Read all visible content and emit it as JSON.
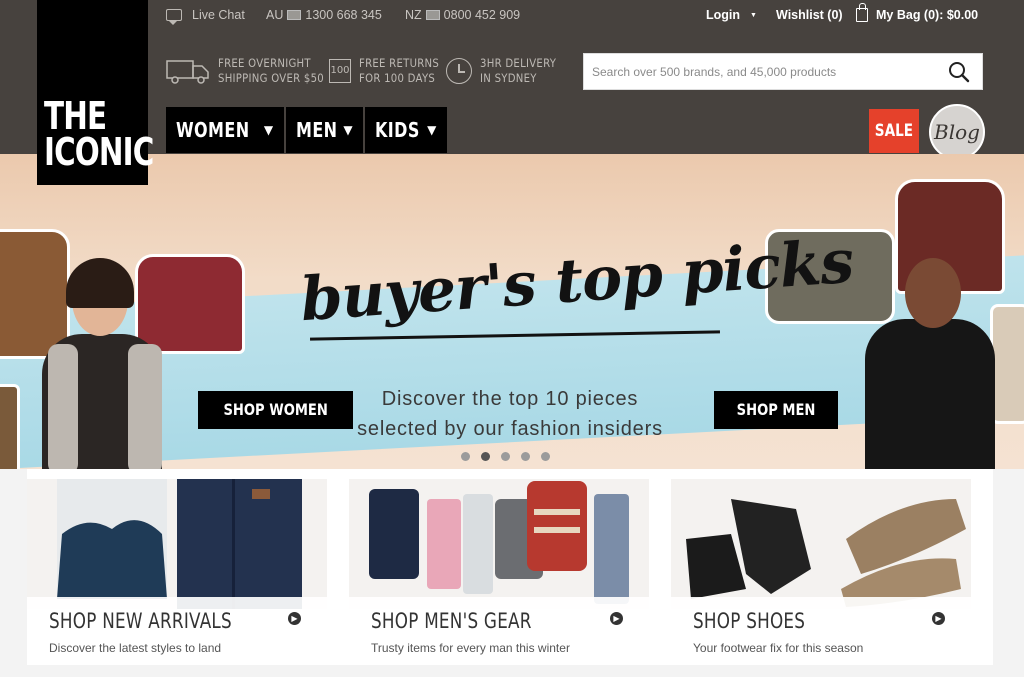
{
  "brand": {
    "line1": "THE",
    "line2": "ICONIC"
  },
  "topbar": {
    "live_chat": "Live Chat",
    "au_label": "AU",
    "au_phone": "1300 668 345",
    "nz_label": "NZ",
    "nz_phone": "0800 452 909",
    "login": "Login",
    "login_caret": "▼",
    "wishlist": "Wishlist (0)",
    "bag": "My Bag (0): $0.00"
  },
  "benefits": [
    {
      "line1": "FREE OVERNIGHT",
      "line2": "SHIPPING OVER $50",
      "icon": "truck-icon"
    },
    {
      "line1": "FREE RETURNS",
      "line2": "FOR 100 DAYS",
      "icon": "returns-box-icon",
      "icon_text": "100"
    },
    {
      "line1": "3HR DELIVERY",
      "line2": "IN SYDNEY",
      "icon": "clock-icon"
    }
  ],
  "search": {
    "placeholder": "Search over 500 brands, and 45,000 products",
    "value": ""
  },
  "nav": [
    {
      "label": "WOMEN",
      "caret": "▼"
    },
    {
      "label": "MEN",
      "caret": "▼"
    },
    {
      "label": "KIDS",
      "caret": "▼"
    }
  ],
  "sale_label": "SALE",
  "blog_label": "Blog",
  "hero": {
    "tagline": "buyer's top picks",
    "copy_line1": "Discover the top 10 pieces",
    "copy_line2": "selected by our fashion insiders",
    "shop_women": "SHOP WOMEN",
    "shop_men": "SHOP MEN",
    "active_slide": 2,
    "slide_count": 5
  },
  "tiles": [
    {
      "title": "SHOP NEW ARRIVALS",
      "subtitle": "Discover the latest styles to land"
    },
    {
      "title": "SHOP MEN'S GEAR",
      "subtitle": "Trusty items for every man this winter"
    },
    {
      "title": "SHOP SHOES",
      "subtitle": "Your footwear fix for this season"
    }
  ],
  "colors": {
    "header_bg": "#47423e",
    "sale": "#e5412b",
    "hero_band": "#a9d9e6",
    "hero_bg": "#f2dcc8"
  }
}
